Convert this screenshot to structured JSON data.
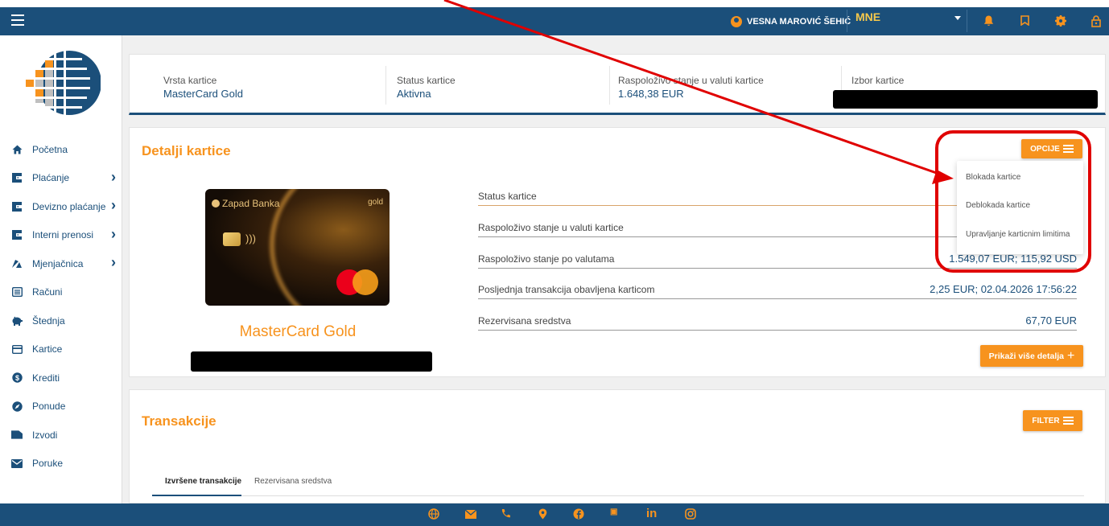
{
  "header": {
    "user_name": "VESNA MAROVIĆ ŠEHIĆ",
    "language": "MNE"
  },
  "sidebar": {
    "items": [
      {
        "label": "Početna",
        "icon": "home-icon",
        "has_arrow": false
      },
      {
        "label": "Plaćanje",
        "icon": "wallet-icon",
        "has_arrow": true
      },
      {
        "label": "Devizno plaćanje",
        "icon": "wallet-icon",
        "has_arrow": true
      },
      {
        "label": "Interni prenosi",
        "icon": "wallet-icon",
        "has_arrow": true
      },
      {
        "label": "Mjenjačnica",
        "icon": "exchange-icon",
        "has_arrow": true
      },
      {
        "label": "Računi",
        "icon": "list-icon",
        "has_arrow": false
      },
      {
        "label": "Štednja",
        "icon": "piggy-bank-icon",
        "has_arrow": false
      },
      {
        "label": "Kartice",
        "icon": "card-icon",
        "has_arrow": false
      },
      {
        "label": "Krediti",
        "icon": "dollar-icon",
        "has_arrow": false
      },
      {
        "label": "Ponude",
        "icon": "compass-icon",
        "has_arrow": false
      },
      {
        "label": "Izvodi",
        "icon": "folder-icon",
        "has_arrow": false
      },
      {
        "label": "Poruke",
        "icon": "mail-icon",
        "has_arrow": false
      }
    ]
  },
  "card_info": {
    "type_label": "Vrsta kartice",
    "type_value": "MasterCard Gold",
    "status_label": "Status kartice",
    "status_value": "Aktivna",
    "balance_label": "Raspoloživo stanje u valuti kartice",
    "balance_value": "1.648,38 EUR",
    "selection_label": "Izbor kartice"
  },
  "details": {
    "title": "Detalji kartice",
    "options_button": "OPCIJE",
    "card_bank": "Zapad Banka",
    "card_tier": "gold",
    "card_name": "MasterCard Gold",
    "rows": [
      {
        "label": "Status kartice",
        "value": ""
      },
      {
        "label": "Raspoloživo stanje u valuti kartice",
        "value": ""
      },
      {
        "label": "Raspoloživo stanje po valutama",
        "value": "1.549,07 EUR; 115,92 USD"
      },
      {
        "label": "Posljednja transakcija obavljena karticom",
        "value": "2,25 EUR; 02.04.2026 17:56:22"
      },
      {
        "label": "Rezervisana sredstva",
        "value": "67,70 EUR"
      }
    ],
    "more_button": "Prikaži više detalja",
    "dropdown": [
      "Blokada kartice",
      "Deblokada kartice",
      "Upravljanje karticnim limitima"
    ]
  },
  "transactions": {
    "title": "Transakcije",
    "filter_button": "FILTER",
    "tabs": [
      "Izvršene transakcije",
      "Rezervisana sredstva"
    ]
  },
  "footer": {
    "icons": [
      "globe-icon",
      "mail-icon",
      "phone-icon",
      "location-icon",
      "facebook-icon",
      "youtube-icon",
      "linkedin-icon",
      "instagram-icon"
    ]
  },
  "colors": {
    "primary": "#1b4f7a",
    "accent": "#f7931e",
    "annotation": "#e00000"
  }
}
